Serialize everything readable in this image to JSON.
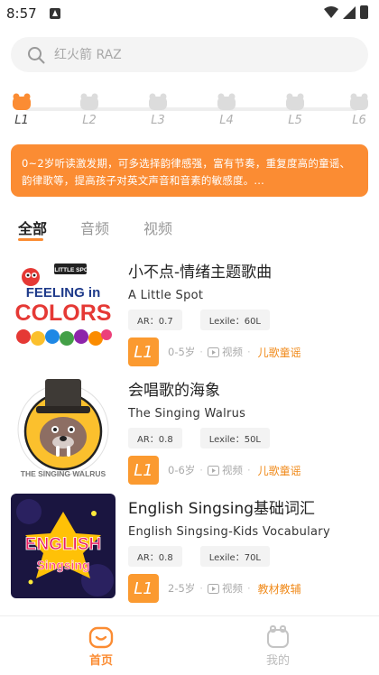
{
  "status_bar": {
    "time": "8:57"
  },
  "search": {
    "placeholder": "红火箭 RAZ"
  },
  "levels": [
    {
      "label": "L1",
      "active": true
    },
    {
      "label": "L2",
      "active": false
    },
    {
      "label": "L3",
      "active": false
    },
    {
      "label": "L4",
      "active": false
    },
    {
      "label": "L5",
      "active": false
    },
    {
      "label": "L6",
      "active": false
    }
  ],
  "description": "0~2岁听读激发期，可多选择韵律感强，富有节奏，重复度高的童谣、韵律歌等，提高孩子对英文声音和音素的敏感度。...",
  "tabs": [
    {
      "label": "全部",
      "active": true
    },
    {
      "label": "音频",
      "active": false
    },
    {
      "label": "视频",
      "active": false
    }
  ],
  "items": [
    {
      "title_cn": "小不点-情绪主题歌曲",
      "title_en": "A Little Spot",
      "ar": "AR：0.7",
      "lexile": "Lexile：60L",
      "level": "L1",
      "age": "0-5岁",
      "type": "视频",
      "category": "儿歌童谣",
      "cover_lines": [
        "FEELING in",
        "COLORS"
      ],
      "cover_small": "A LITTLE SPOT"
    },
    {
      "title_cn": "会唱歌的海象",
      "title_en": "The Singing Walrus",
      "ar": "AR：0.8",
      "lexile": "Lexile：50L",
      "level": "L1",
      "age": "0-6岁",
      "type": "视频",
      "category": "儿歌童谣",
      "cover_lines": [
        "THE SINGING WALRUS"
      ]
    },
    {
      "title_cn": "English Singsing基础词汇",
      "title_en": "English Singsing-Kids Vocabulary",
      "ar": "AR：0.8",
      "lexile": "Lexile：70L",
      "level": "L1",
      "age": "2-5岁",
      "type": "视频",
      "category": "教材教辅",
      "cover_lines": [
        "ENGLISH",
        "Singsing"
      ]
    }
  ],
  "bottom_nav": [
    {
      "label": "首页",
      "active": true
    },
    {
      "label": "我的",
      "active": false
    }
  ],
  "colors": {
    "accent": "#fb8c33",
    "category": "#f08a1a",
    "chip": "#fb9a30"
  },
  "separator": "·"
}
